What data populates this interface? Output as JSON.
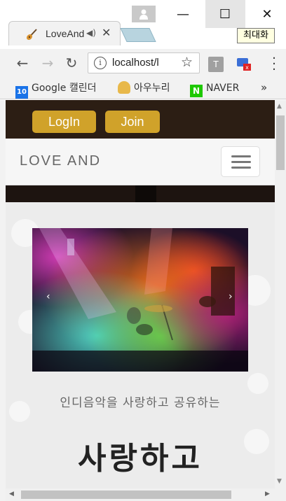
{
  "browser": {
    "tab": {
      "title": "LoveAnd",
      "audio_icon": "speaker-icon",
      "close_symbol": "✕"
    },
    "window": {
      "minimize_symbol": "—",
      "maximize_symbol": "☐",
      "close_symbol": "✕",
      "tooltip": "최대화"
    },
    "toolbar": {
      "back_symbol": "←",
      "forward_symbol": "→",
      "reload_symbol": "↻",
      "url": "localhost/l",
      "star_symbol": "☆",
      "ext_t_label": "T"
    },
    "bookmarks": [
      {
        "label": "Google 캘린더",
        "icon": "calendar-icon",
        "icon_text": "10",
        "color": "#1a73e8"
      },
      {
        "label": "아우누리",
        "icon": "aunuri-icon",
        "icon_text": "",
        "color": "#e8b84a"
      },
      {
        "label": "NAVER",
        "icon": "naver-icon",
        "icon_text": "N",
        "color": "#1ec800"
      }
    ],
    "bookmarks_more": "»"
  },
  "page": {
    "login_label": "LogIn",
    "join_label": "Join",
    "brand": "LOVE AND",
    "carousel": {
      "prev_symbol": "‹",
      "next_symbol": "›"
    },
    "tagline": "인디음악을 사랑하고 공유하는",
    "headline": "사랑하고"
  },
  "colors": {
    "accent_button": "#d0a22a",
    "top_strip": "#2c1e14",
    "navbar": "#f6f6f6"
  }
}
